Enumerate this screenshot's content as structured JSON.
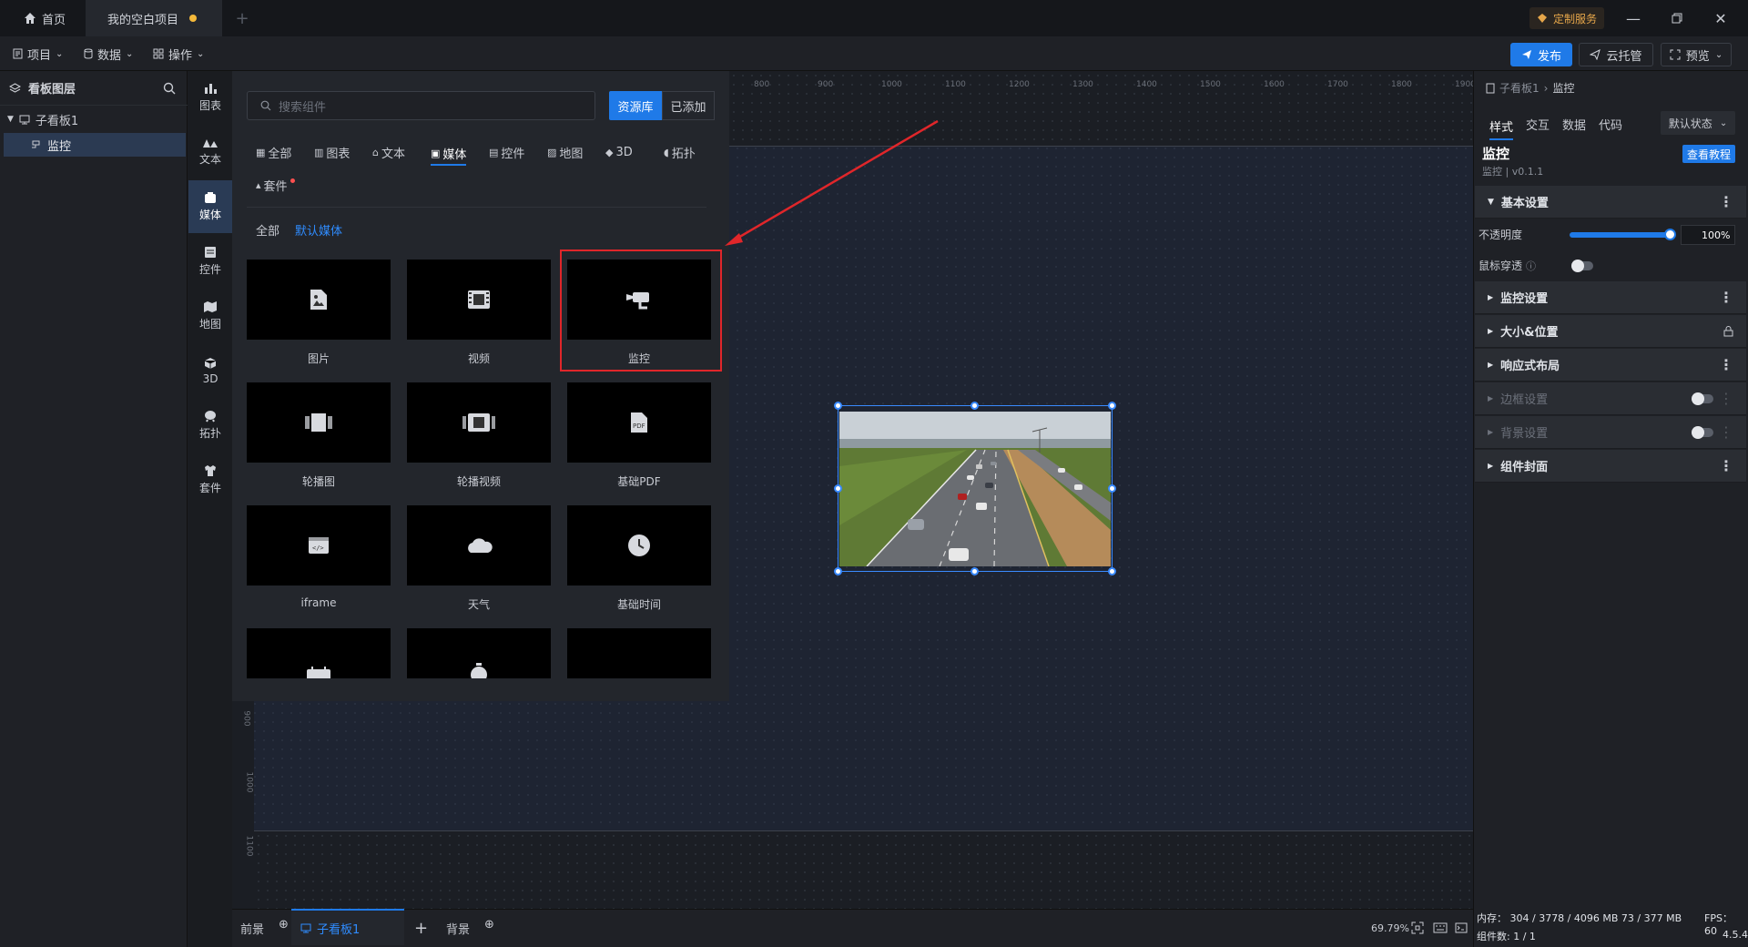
{
  "titlebar": {
    "home_tab": "首页",
    "project_tab": "我的空白项目",
    "custom_service": "定制服务",
    "colors": {
      "unsaved_dot": "#f5b93a",
      "accent": "#1f7ae8",
      "highlight_box": "#e0262a"
    }
  },
  "toolbar": {
    "project": "项目",
    "data": "数据",
    "operate": "操作",
    "publish": "发布",
    "hosting": "云托管",
    "preview": "预览"
  },
  "layers": {
    "title": "看板图层",
    "board": "子看板1",
    "item": "监控"
  },
  "categories": [
    "图表",
    "文本",
    "媒体",
    "控件",
    "地图",
    "3D",
    "拓扑",
    "套件"
  ],
  "active_category": "媒体",
  "resource": {
    "search_placeholder": "搜索组件",
    "lib_tab": "资源库",
    "added_tab": "已添加",
    "filters": [
      "全部",
      "图表",
      "文本",
      "媒体",
      "控件",
      "地图",
      "3D",
      "拓扑",
      "套件"
    ],
    "active_filter": "媒体",
    "sub_all": "全部",
    "sub_default": "默认媒体",
    "cards": [
      "图片",
      "视频",
      "监控",
      "轮播图",
      "轮播视频",
      "基础PDF",
      "iframe",
      "天气",
      "基础时间"
    ],
    "highlighted_card": "监控"
  },
  "ruler": [
    "800",
    "900",
    "1000",
    "1100",
    "1200",
    "1300",
    "1400",
    "1500",
    "1600",
    "1700",
    "1800",
    "1900"
  ],
  "vruler": [
    "900",
    "1000",
    "1100"
  ],
  "bottom": {
    "foreground": "前景",
    "board_tab": "子看板1",
    "background": "背景",
    "zoom": "69.79%"
  },
  "right_panel": {
    "breadcrumb_board": "子看板1",
    "breadcrumb_item": "监控",
    "tabs": [
      "样式",
      "交互",
      "数据",
      "代码"
    ],
    "state": "默认状态",
    "component_name": "监控",
    "component_version": "监控 | v0.1.1",
    "tutorial": "查看教程",
    "basic_settings": "基本设置",
    "opacity_label": "不透明度",
    "opacity_value": "100",
    "opacity_unit": "%",
    "opacity_fraction": 1.0,
    "mouse_through": "鼠标穿透",
    "sections": [
      "监控设置",
      "大小&位置",
      "响应式布局",
      "边框设置",
      "背景设置",
      "组件封面"
    ]
  },
  "status": {
    "memory": "内存： 304 / 3778 / 4096 MB  73 / 377 MB",
    "fps": "FPS： 60",
    "components": "组件数: 1 / 1",
    "version": "4.5.4"
  }
}
